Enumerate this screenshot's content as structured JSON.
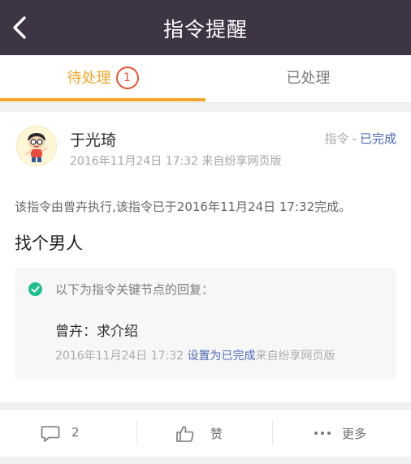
{
  "header": {
    "title": "指令提醒",
    "back_icon": "chevron-left-icon"
  },
  "tabs": [
    {
      "label": "待处理",
      "badge": "1",
      "active": true
    },
    {
      "label": "已处理",
      "active": false
    }
  ],
  "colors": {
    "header_bg": "#3d3444",
    "accent": "#f2a526",
    "badge": "#e9512f",
    "link": "#4a69b7",
    "check": "#1fbf92"
  },
  "instruction": {
    "author": "于光琦",
    "meta": "2016年11月24日 17:32  来自纷享网页版",
    "type": "指令",
    "separator": "-",
    "status": "已完成",
    "description": "该指令由曾卉执行,该指令已于2016年11月24日 17:32完成。",
    "subject": "找个男人",
    "reply": {
      "header": "以下为指令关键节点的回复：",
      "author_line": "曾卉：求介绍",
      "time": "2016年11月24日 17:32",
      "action_link": "设置为已完成",
      "source": "来自纷享网页版"
    }
  },
  "actions": [
    {
      "icon": "comment-icon",
      "label": "2"
    },
    {
      "icon": "thumbs-up-icon",
      "label": "赞"
    },
    {
      "icon": "more-icon",
      "label": "更多"
    }
  ]
}
